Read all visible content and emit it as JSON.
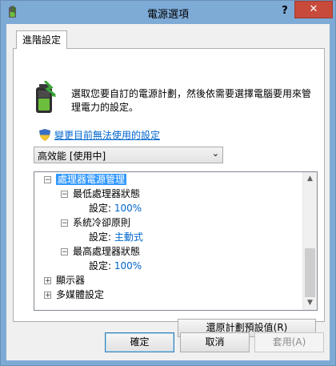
{
  "window": {
    "title": "電源選項",
    "help_label": "?",
    "close_label": "✕"
  },
  "tab": {
    "label": "進階設定"
  },
  "description": "選取您要自訂的電源計劃，然後依需要選擇電腦要用來管理電力的設定。",
  "change_link": "變更目前無法使用的設定",
  "plan_select": {
    "value": "高效能 [使用中]"
  },
  "tree": {
    "root": "處理器電源管理",
    "items": [
      {
        "label": "最低處理器狀態",
        "setting_label": "設定:",
        "setting_value": "100%"
      },
      {
        "label": "系統冷卻原則",
        "setting_label": "設定:",
        "setting_value": "主動式"
      },
      {
        "label": "最高處理器狀態",
        "setting_label": "設定:",
        "setting_value": "100%"
      }
    ],
    "collapsed": [
      "顯示器",
      "多媒體設定"
    ]
  },
  "buttons": {
    "restore": "還原計劃預設值(R)",
    "ok": "確定",
    "cancel": "取消",
    "apply": "套用(A)"
  },
  "colors": {
    "titlebar": "#7eaad6",
    "close": "#c74a3a",
    "selection": "#3399ff",
    "link": "#0066cc"
  },
  "icons": [
    "power-plan-icon",
    "battery-icon",
    "shield-icon",
    "help-icon",
    "close-icon",
    "chevron-down-icon",
    "expand-icon",
    "collapse-icon",
    "scroll-up-icon",
    "scroll-down-icon"
  ]
}
